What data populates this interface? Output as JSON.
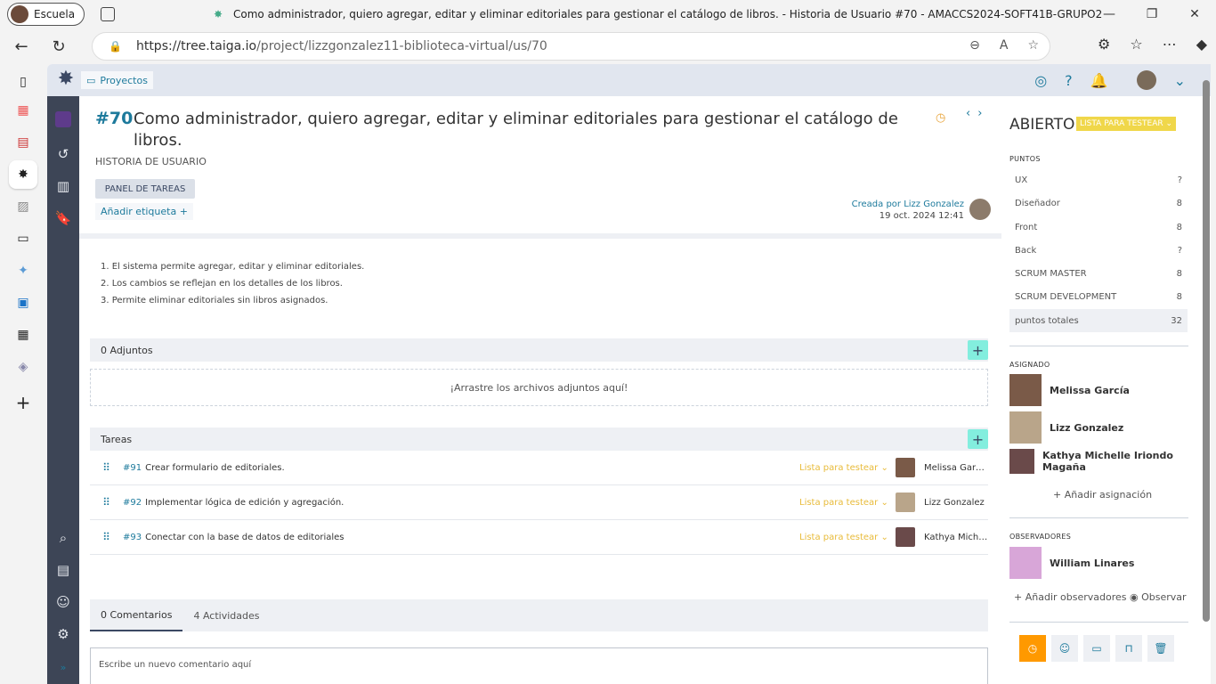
{
  "browser": {
    "profile_label": "Escuela",
    "window_title": "Como administrador, quiero agregar, editar y eliminar editoriales para gestionar el catálogo de libros. - Historia de Usuario #70 - AMACCS2024-SOFT41B-GRUPO2",
    "url_host": "https://tree.taiga.io",
    "url_path": "/project/lizzgonzalez11-biblioteca-virtual/us/70"
  },
  "topnav": {
    "breadcrumb": "Proyectos"
  },
  "story": {
    "ref": "#70",
    "subject": "Como administrador, quiero agregar, editar y eliminar editoriales para gestionar el catálogo de libros.",
    "type_label": "HISTORIA DE USUARIO",
    "task_panel_label": "PANEL DE TAREAS",
    "add_tag_label": "Añadir etiqueta",
    "created_by": "Creada por Lizz Gonzalez",
    "created_date": "19 oct. 2024 12:41",
    "description": [
      "1. El sistema permite agregar, editar y eliminar editoriales.",
      "2. Los cambios se reflejan en los detalles de los libros.",
      "3. Permite eliminar editoriales sin libros asignados."
    ]
  },
  "attachments": {
    "header": "0 Adjuntos",
    "dropzone": "¡Arrastre los archivos adjuntos aquí!"
  },
  "tasks": {
    "header": "Tareas",
    "items": [
      {
        "ref": "#91",
        "name": "Crear formulario de editoriales.",
        "status": "Lista para testear",
        "user": "Melissa García"
      },
      {
        "ref": "#92",
        "name": "Implementar lógica de edición y agregación.",
        "status": "Lista para testear",
        "user": "Lizz Gonzalez"
      },
      {
        "ref": "#93",
        "name": "Conectar con la base de datos de editoriales",
        "status": "Lista para testear",
        "user": "Kathya Michelle Iriondo Magaña"
      }
    ]
  },
  "activity": {
    "tab_comments": "0 Comentarios",
    "tab_activities": "4 Actividades",
    "comment_placeholder": "Escribe un nuevo comentario aquí"
  },
  "sidebar": {
    "status": "ABIERTO",
    "status_badge": "LISTA PARA TESTEAR",
    "points_header": "PUNTOS",
    "points": [
      {
        "role": "UX",
        "value": "?"
      },
      {
        "role": "Diseñador",
        "value": "8"
      },
      {
        "role": "Front",
        "value": "8"
      },
      {
        "role": "Back",
        "value": "?"
      },
      {
        "role": "SCRUM MASTER",
        "value": "8"
      },
      {
        "role": "SCRUM DEVELOPMENT",
        "value": "8"
      },
      {
        "role": "puntos totales",
        "value": "32"
      }
    ],
    "assigned_header": "ASIGNADO",
    "assigned": [
      "Melissa García",
      "Lizz Gonzalez",
      "Kathya Michelle Iriondo Magaña"
    ],
    "add_assignment": "Añadir asignación",
    "watchers_header": "OBSERVADORES",
    "watchers": [
      "William Linares"
    ],
    "add_watchers": "Añadir observadores",
    "watch": "Observar"
  }
}
